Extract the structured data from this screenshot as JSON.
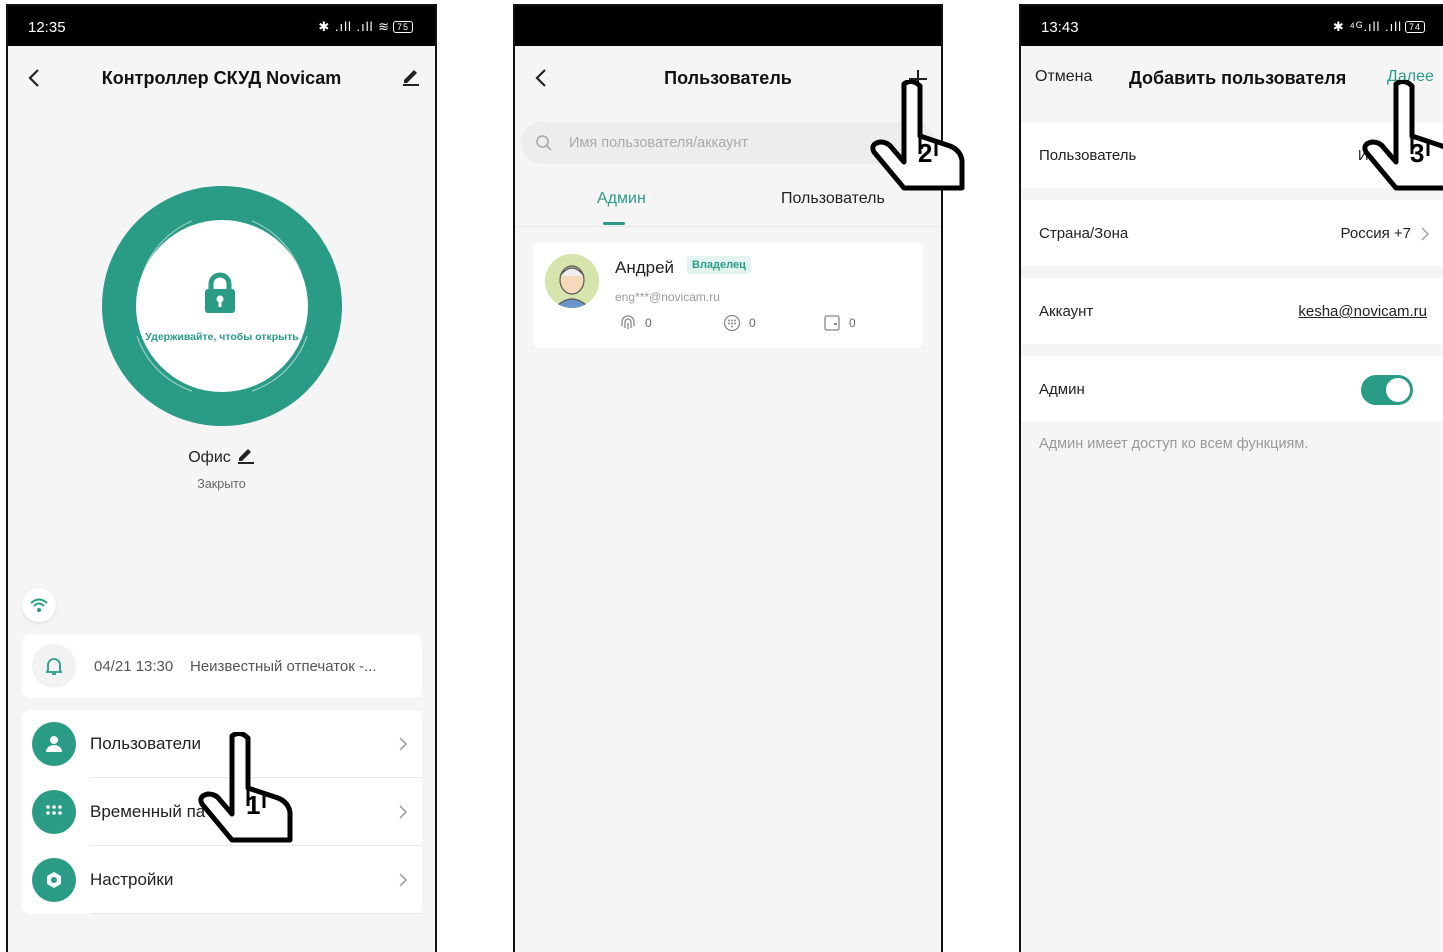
{
  "screen1": {
    "status_time": "12:35",
    "status_icons": "✱ .ıll .ıll ≋",
    "battery": "75",
    "title": "Контроллер СКУД Novicam",
    "hold_text": "Удерживайте, чтобы открыть",
    "place_name": "Офис",
    "lock_state": "Закрыто",
    "notification": {
      "time": "04/21 13:30",
      "text": "Неизвестный отпечаток -..."
    },
    "menu": [
      {
        "label": "Пользователи",
        "icon": "user-icon"
      },
      {
        "label": "Временный па",
        "icon": "keypad-icon"
      },
      {
        "label": "Настройки",
        "icon": "settings-icon"
      }
    ],
    "step": "1"
  },
  "screen2": {
    "title": "Пользователь",
    "search_placeholder": "Имя пользователя/аккаунт",
    "tabs": [
      "Админ",
      "Пользователь"
    ],
    "user": {
      "name": "Андрей",
      "badge": "Владелец",
      "email": "eng***@novicam.ru",
      "fingerprints": "0",
      "passwords": "0",
      "cards": "0"
    },
    "step": "2"
  },
  "screen3": {
    "status_time": "13:43",
    "status_icons": "✱ ⁴ᴳ.ıll .ıll",
    "battery": "74",
    "cancel_label": "Отмена",
    "title": "Добавить пользователя",
    "next_label": "Далее",
    "rows": {
      "user_label": "Пользователь",
      "user_value": "Ин",
      "country_label": "Страна/Зона",
      "country_value": "Россия +7",
      "account_label": "Аккаунт",
      "account_value": "kesha@novicam.ru",
      "admin_label": "Админ"
    },
    "admin_enabled": true,
    "hint": "Админ имеет доступ ко всем функциям.",
    "step": "3"
  },
  "colors": {
    "accent": "#2a9c86",
    "background": "#f5f5f5",
    "statusbar": "#000000"
  }
}
